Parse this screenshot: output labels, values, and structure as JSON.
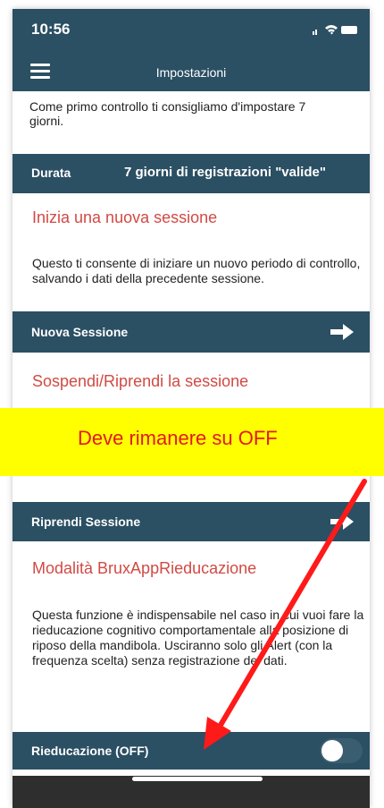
{
  "status_bar": {
    "time": "10:56"
  },
  "nav": {
    "title": "Impostazioni",
    "menu_icon": "hamburger-menu-icon"
  },
  "intro_text": "Come primo controllo ti consigliamo d'impostare 7 giorni.",
  "duration_row": {
    "label": "Durata",
    "value": "7 giorni di registrazioni \"valide\""
  },
  "new_session": {
    "title": "Inizia una nuova sessione",
    "description": "Questo ti consente di iniziare un nuovo periodo di controllo, salvando i dati della precedente sessione.",
    "button_label": "Nuova Sessione"
  },
  "suspend_section": {
    "title": "Sospendi/Riprendi la sessione"
  },
  "annotation": {
    "text": "Deve rimanere su OFF",
    "highlight_color": "#ffff00",
    "text_color": "#e21a1a"
  },
  "resume": {
    "button_label": "Riprendi Sessione"
  },
  "reeducation": {
    "title": "Modalità BruxAppRieducazione",
    "description": "Questa funzione è indispensabile nel caso in cui vuoi fare la rieducazione cognitivo comportamentale alla posizione di riposo della mandibola. Usciranno solo gli Alert (con la frequenza scelta) senza registrazione dei dati.",
    "toggle_label": "Rieducazione (OFF)",
    "toggle_state": "off"
  },
  "colors": {
    "bar": "#2b4f63",
    "accent_red": "#d14a44",
    "arrow_red": "#ff1a1a"
  }
}
